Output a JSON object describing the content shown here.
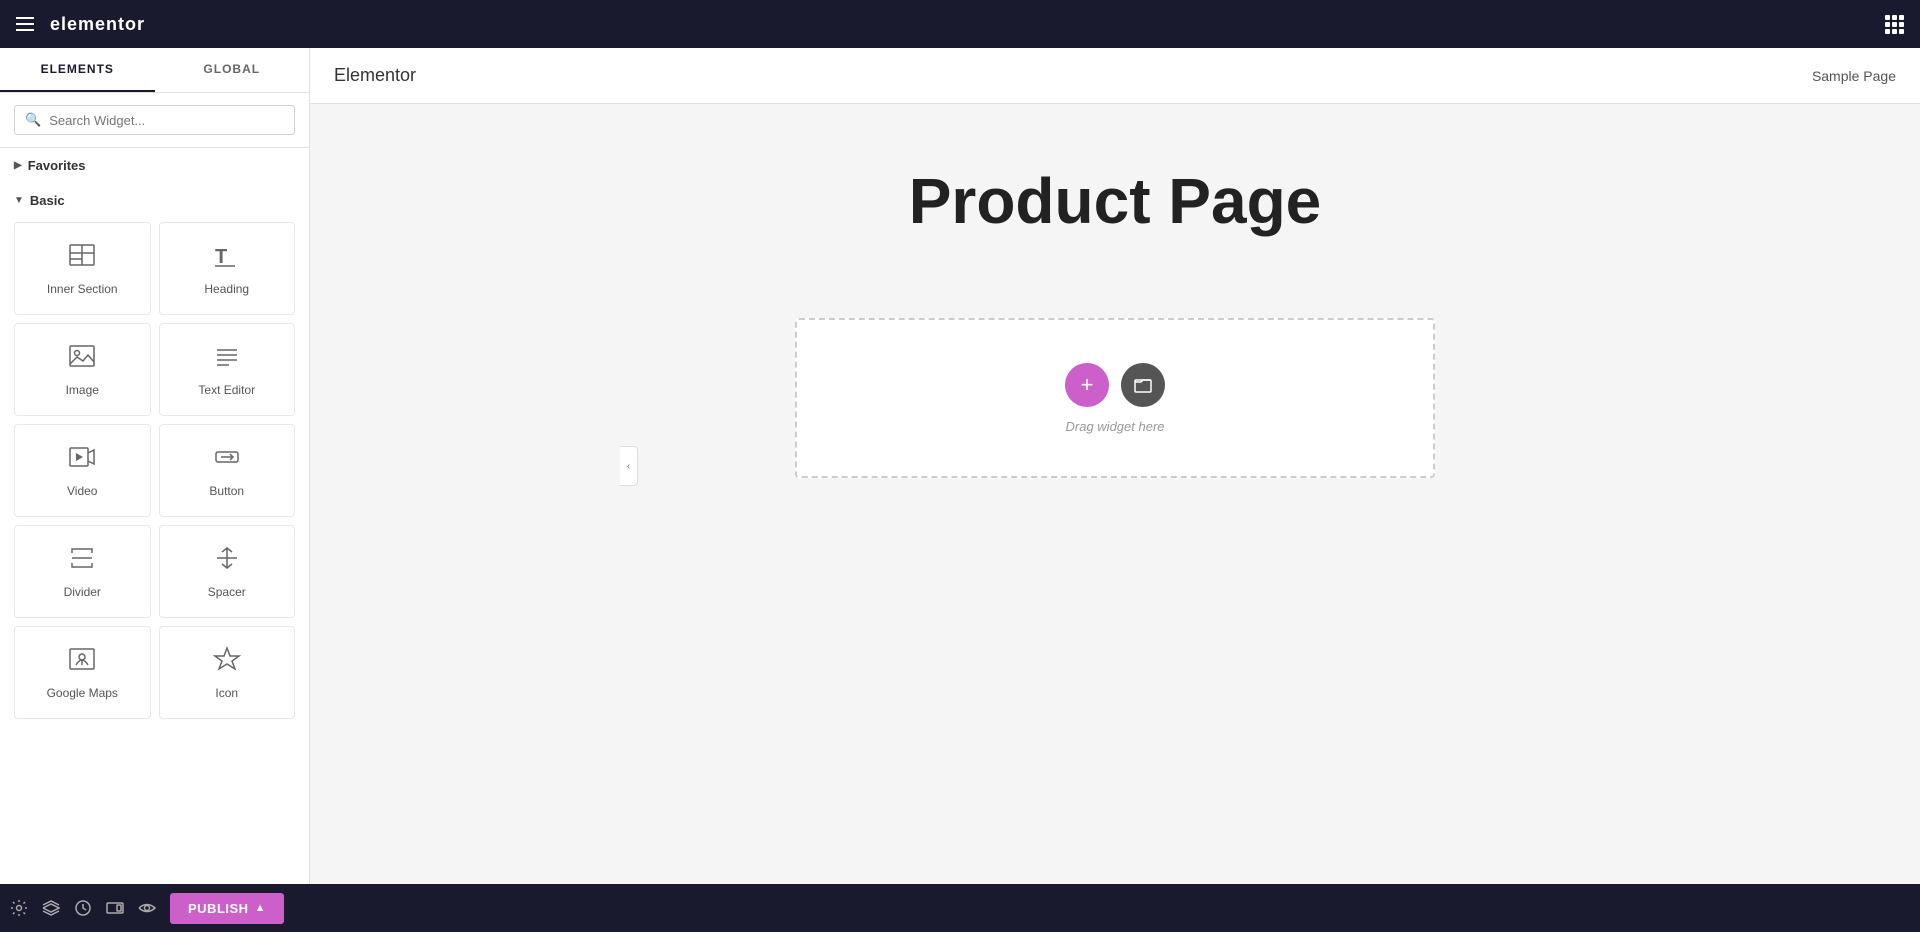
{
  "topbar": {
    "logo": "elementor",
    "hamburger_label": "menu",
    "grid_label": "apps"
  },
  "sidebar": {
    "tabs": [
      {
        "id": "elements",
        "label": "ELEMENTS",
        "active": true
      },
      {
        "id": "global",
        "label": "GLOBAL",
        "active": false
      }
    ],
    "search": {
      "placeholder": "Search Widget..."
    },
    "sections": [
      {
        "id": "favorites",
        "label": "Favorites",
        "collapsed": true,
        "arrow": "▶"
      },
      {
        "id": "basic",
        "label": "Basic",
        "collapsed": false,
        "arrow": "▼",
        "widgets": [
          {
            "id": "inner-section",
            "label": "Inner Section",
            "icon": "inner-section"
          },
          {
            "id": "heading",
            "label": "Heading",
            "icon": "heading"
          },
          {
            "id": "image",
            "label": "Image",
            "icon": "image"
          },
          {
            "id": "text-editor",
            "label": "Text Editor",
            "icon": "text-editor"
          },
          {
            "id": "video",
            "label": "Video",
            "icon": "video"
          },
          {
            "id": "button",
            "label": "Button",
            "icon": "button"
          },
          {
            "id": "divider",
            "label": "Divider",
            "icon": "divider"
          },
          {
            "id": "spacer",
            "label": "Spacer",
            "icon": "spacer"
          },
          {
            "id": "google-maps",
            "label": "Google Maps",
            "icon": "google-maps"
          },
          {
            "id": "icon",
            "label": "Icon",
            "icon": "icon"
          }
        ]
      }
    ]
  },
  "bottom_toolbar": {
    "icons": [
      "settings",
      "layers",
      "history",
      "responsive",
      "eye"
    ],
    "publish_label": "PUBLISH",
    "publish_chevron": "▲"
  },
  "canvas": {
    "topbar_logo": "Elementor",
    "topbar_page": "Sample Page",
    "page_title": "Product Page",
    "drop_zone_text": "Drag widget here"
  },
  "colors": {
    "brand_dark": "#1a1a2e",
    "accent_pink": "#cc5fc9",
    "dark_btn": "#555555"
  }
}
